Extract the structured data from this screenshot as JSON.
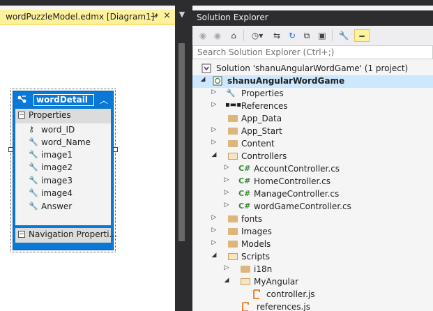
{
  "designer": {
    "tab_title": "wordPuzzleModel.edmx [Diagram1]*",
    "pin_glyph": "⊸",
    "close_glyph": "×",
    "entity": {
      "name": "wordDetail",
      "properties_label": "Properties",
      "properties": [
        {
          "name": "word_ID",
          "icon": "key-icon"
        },
        {
          "name": "word_Name",
          "icon": "wrench-icon"
        },
        {
          "name": "image1",
          "icon": "wrench-icon"
        },
        {
          "name": "image2",
          "icon": "wrench-icon"
        },
        {
          "name": "image3",
          "icon": "wrench-icon"
        },
        {
          "name": "image4",
          "icon": "wrench-icon"
        },
        {
          "name": "Answer",
          "icon": "wrench-icon"
        }
      ],
      "navigation_label": "Navigation  Properti..."
    }
  },
  "solution_explorer": {
    "title": "Solution Explorer",
    "search_placeholder": "Search Solution Explorer (Ctrl+;)",
    "tree": [
      {
        "label": "Solution 'shanuAngularWordGame' (1 project)",
        "icon": "solution-icon",
        "expander": ""
      },
      {
        "label": "shanuAngularWordGame",
        "icon": "web-project-icon",
        "expander": "◢"
      },
      {
        "label": "Properties",
        "icon": "wrench-icon",
        "expander": "▷"
      },
      {
        "label": "References",
        "icon": "references-icon",
        "expander": "▷"
      },
      {
        "label": "App_Data",
        "icon": "folder-icon",
        "expander": ""
      },
      {
        "label": "App_Start",
        "icon": "folder-icon",
        "expander": "▷"
      },
      {
        "label": "Content",
        "icon": "folder-icon",
        "expander": "▷"
      },
      {
        "label": "Controllers",
        "icon": "folder-open-icon",
        "expander": "◢"
      },
      {
        "label": "AccountController.cs",
        "icon": "csharp-icon",
        "expander": "▷"
      },
      {
        "label": "HomeController.cs",
        "icon": "csharp-icon",
        "expander": "▷"
      },
      {
        "label": "ManageController.cs",
        "icon": "csharp-icon",
        "expander": "▷"
      },
      {
        "label": "wordGameController.cs",
        "icon": "csharp-icon",
        "expander": "▷"
      },
      {
        "label": "fonts",
        "icon": "folder-icon",
        "expander": "▷"
      },
      {
        "label": "Images",
        "icon": "folder-icon",
        "expander": "▷"
      },
      {
        "label": "Models",
        "icon": "folder-icon",
        "expander": "▷"
      },
      {
        "label": "Scripts",
        "icon": "folder-open-icon",
        "expander": "◢"
      },
      {
        "label": "i18n",
        "icon": "folder-icon",
        "expander": "▷"
      },
      {
        "label": "MyAngular",
        "icon": "folder-open-icon",
        "expander": "◢"
      },
      {
        "label": "controller.js",
        "icon": "js-file-icon",
        "expander": ""
      },
      {
        "label": "references.js",
        "icon": "js-file-icon",
        "expander": ""
      }
    ]
  },
  "colors": {
    "tab_active": "#fff29d",
    "entity_blue": "#0a78d7",
    "selection": "#cce8ff",
    "chrome_dark": "#2d2d30"
  }
}
